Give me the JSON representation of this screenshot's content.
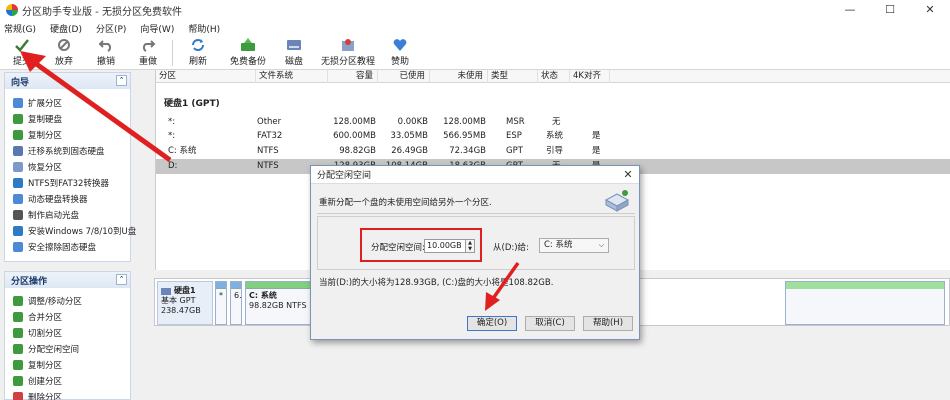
{
  "window": {
    "title": "分区助手专业版 - 无损分区免费软件",
    "controls": [
      "—",
      "☐",
      "✕"
    ]
  },
  "menu": [
    "常规(G)",
    "硬盘(D)",
    "分区(P)",
    "向导(W)",
    "帮助(H)"
  ],
  "toolbar": {
    "buttons": [
      {
        "label": "提交",
        "icon": "check-icon"
      },
      {
        "label": "放弃",
        "icon": "discard-icon"
      },
      {
        "label": "撤销",
        "icon": "undo-icon"
      },
      {
        "label": "重做",
        "icon": "redo-icon"
      },
      {
        "label": "刷新",
        "icon": "refresh-icon"
      },
      {
        "label": "免费备份",
        "icon": "backup-icon"
      },
      {
        "label": "无损分区教程",
        "icon": "tutorial-icon"
      },
      {
        "label": "赞助",
        "icon": "heart-icon"
      }
    ]
  },
  "sidebar": {
    "wizard_title": "向导",
    "wizard_items": [
      "扩展分区",
      "复制硬盘",
      "复制分区",
      "迁移系统到固态硬盘",
      "恢复分区",
      "NTFS到FAT32转换器",
      "动态硬盘转换器",
      "制作启动光盘",
      "安装Windows 7/8/10到U盘",
      "安全擦除固态硬盘"
    ],
    "ops_title": "分区操作",
    "ops_items": [
      "调整/移动分区",
      "合并分区",
      "切割分区",
      "分配空闲空间",
      "复制分区",
      "创建分区",
      "删除分区"
    ]
  },
  "grid": {
    "columns": [
      "分区",
      "文件系统",
      "容量",
      "已使用",
      "未使用",
      "类型",
      "状态",
      "4K对齐"
    ],
    "disk_title": "硬盘1 (GPT)",
    "rows": [
      [
        "*:",
        "Other",
        "128.00MB",
        "0.00KB",
        "128.00MB",
        "MSR",
        "无",
        ""
      ],
      [
        "*:",
        "FAT32",
        "600.00MB",
        "33.05MB",
        "566.95MB",
        "ESP",
        "系统",
        "是"
      ],
      [
        "C: 系统",
        "NTFS",
        "98.82GB",
        "26.49GB",
        "72.34GB",
        "GPT",
        "引导",
        "是"
      ],
      [
        "D:",
        "NTFS",
        "128.93GB",
        "108.14GB",
        "18.63GB",
        "GPT",
        "无",
        "是"
      ]
    ]
  },
  "diskmap": {
    "disk_name": "硬盘1",
    "disk_type": "基本 GPT",
    "disk_size": "238.47GB",
    "seg1": "*",
    "seg2": "6.",
    "c_name": "C: 系统",
    "c_info": "98.82GB NTFS"
  },
  "dialog": {
    "title": "分配空闲空间",
    "description": "重新分配一个盘的未使用空间给另外一个分区.",
    "alloc_label": "分配空闲空间:",
    "alloc_value": "10.00GB",
    "from_label": "从(D:)给:",
    "target_value": "C: 系统",
    "info": "当前(D:)的大小将为128.93GB, (C:)盘的大小将是108.82GB.",
    "ok": "确定(O)",
    "cancel": "取消(C)",
    "help": "帮助(H)"
  },
  "colors": {
    "arrow": "#e02020",
    "selected_row": "#c7c7c7",
    "partition_bar": "#7fb0e0",
    "c_bar": "#80d080"
  }
}
